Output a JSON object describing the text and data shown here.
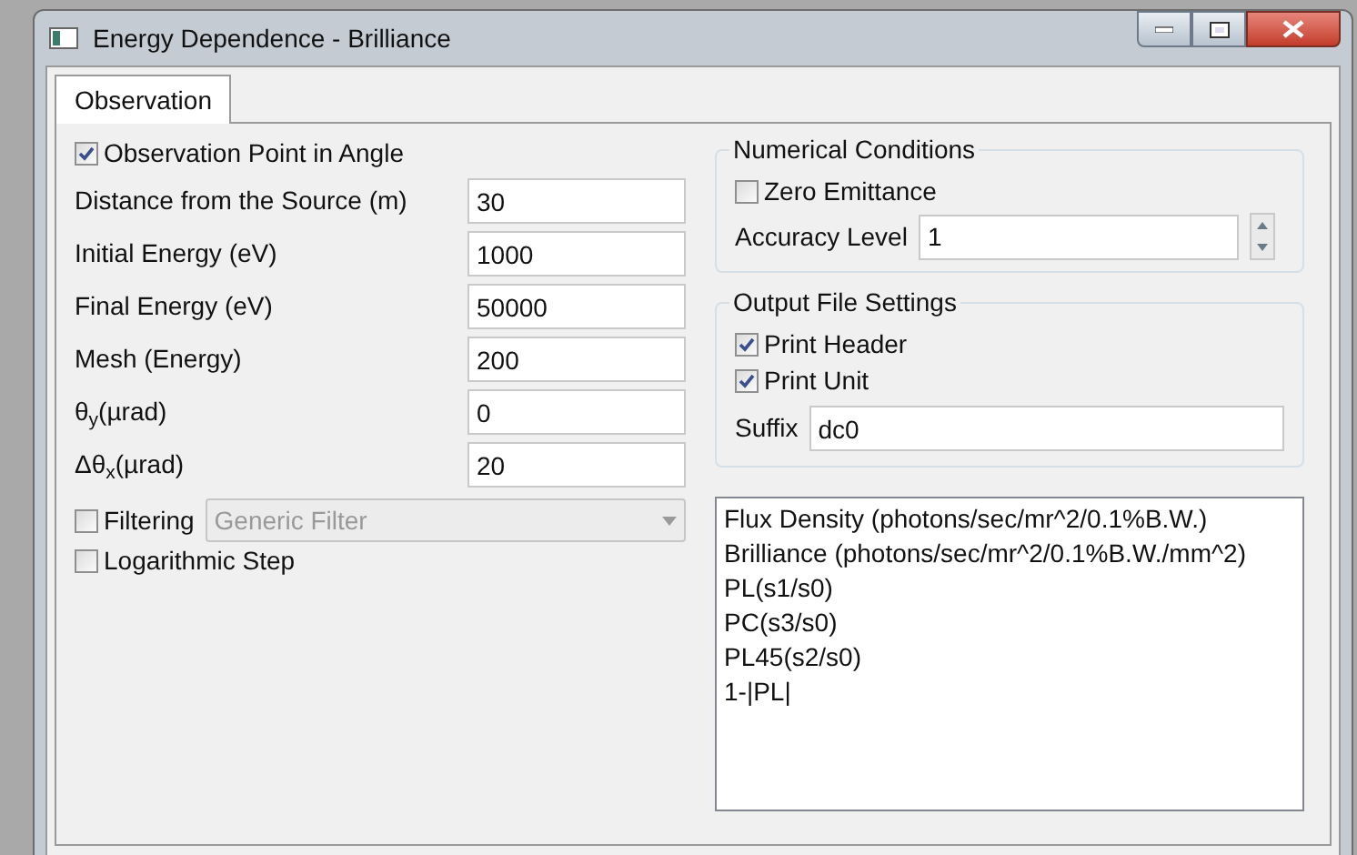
{
  "window": {
    "title": "Energy Dependence - Brilliance"
  },
  "tabs": [
    {
      "label": "Observation",
      "selected": true
    }
  ],
  "observation_point": {
    "label": "Observation Point in Angle",
    "checked": true
  },
  "fields": [
    {
      "label": "Distance from the Source (m)",
      "value": "30"
    },
    {
      "label": "Initial Energy (eV)",
      "value": "1000"
    },
    {
      "label": "Final Energy (eV)",
      "value": "50000"
    },
    {
      "label": "Mesh (Energy)",
      "value": "200"
    },
    {
      "label": "θ$_{y}$(µrad)",
      "value": "0"
    },
    {
      "label": "Δθ$_{x}$(µrad)",
      "value": "20"
    }
  ],
  "filtering": {
    "label": "Filtering",
    "checked": false,
    "dropdown": {
      "value": "Generic Filter",
      "disabled": true
    }
  },
  "logarithmic_step": {
    "label": "Logarithmic Step",
    "checked": false
  },
  "numerical_conditions": {
    "title": "Numerical Conditions",
    "zero_emittance": {
      "label": "Zero Emittance",
      "checked": false
    },
    "accuracy_level": {
      "label": "Accuracy Level",
      "value": "1"
    }
  },
  "output_file_settings": {
    "title": "Output File Settings",
    "checkboxes": [
      {
        "label": "Print Header",
        "checked": true
      },
      {
        "label": "Print Unit",
        "checked": true
      }
    ],
    "suffix": {
      "label": "Suffix",
      "value": "dc0"
    }
  },
  "output_list": [
    "Flux Density (photons/sec/mr^2/0.1%B.W.)",
    "Brilliance (photons/sec/mr^2/0.1%B.W./mm^2)",
    "PL(s1/s0)",
    "PC(s3/s0)",
    "PL45(s2/s0)",
    "1-|PL|"
  ]
}
